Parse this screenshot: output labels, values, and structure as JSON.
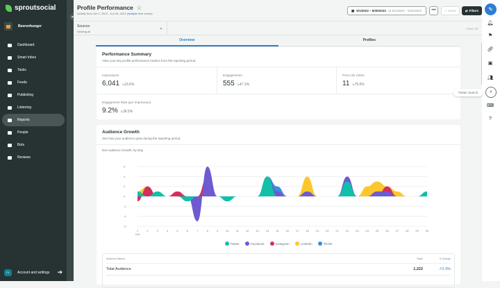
{
  "sidebar": {
    "brand": "sproutsocial",
    "group": "Beerenhunger",
    "items": [
      {
        "label": "Dashboard"
      },
      {
        "label": "Smart Inbox"
      },
      {
        "label": "Tasks"
      },
      {
        "label": "Feeds"
      },
      {
        "label": "Publishing"
      },
      {
        "label": "Listening"
      },
      {
        "label": "Reports",
        "active": true
      },
      {
        "label": "People"
      },
      {
        "label": "Bots"
      },
      {
        "label": "Reviews"
      }
    ],
    "account": {
      "initials": "FL",
      "label": "Account and settings"
    }
  },
  "header": {
    "title": "Profile Performance",
    "subtitle_prefix": "Activity from Jun 1, 2023 - Jun 30, 2023 (",
    "subtitle_link": "multiple",
    "subtitle_suffix": " time zones)",
    "date_range": "6/1/2023 – 6/30/2023",
    "compare": "vs 5/1/2023 – 5/31/2023",
    "more": "•••",
    "share": "Share",
    "filters": "Filters"
  },
  "sources": {
    "label": "Sources",
    "value": "Viewing all",
    "clear": "Clear All"
  },
  "tabs": [
    {
      "label": "Overview",
      "active": true
    },
    {
      "label": "Profiles"
    }
  ],
  "performance": {
    "title": "Performance Summary",
    "description": "View your key profile performance metrics from the reporting period.",
    "metrics": [
      {
        "label": "Impressions",
        "value": "6,041",
        "change": "↘16.6%"
      },
      {
        "label": "Engagements",
        "value": "555",
        "change": "↘47.1%"
      },
      {
        "label": "Post Link Clicks",
        "value": "11",
        "change": "↘75.6%"
      },
      {
        "label": "Engagement Rate (per Impression)",
        "value": "9.2%",
        "change": "↘36.5%"
      }
    ]
  },
  "audience": {
    "title": "Audience Growth",
    "description": "See how your audience grew during the reporting period.",
    "table": {
      "headers": [
        "Audience Metrics",
        "Totals",
        "% Change"
      ],
      "rows": [
        {
          "metric": "Total Audience",
          "total": "1,222",
          "change": "↗2.3%"
        }
      ]
    }
  },
  "chart_data": {
    "type": "area",
    "title": "Net Audience Growth, by Day",
    "x_month_label": "JUN",
    "x": [
      1,
      2,
      3,
      4,
      5,
      6,
      7,
      8,
      9,
      10,
      11,
      12,
      13,
      14,
      15,
      16,
      17,
      18,
      19,
      20,
      21,
      22,
      23,
      24,
      25,
      26,
      27,
      28,
      29,
      30
    ],
    "ylim": [
      -6,
      6
    ],
    "yticks": [
      6,
      4,
      2,
      0,
      -2,
      -4,
      -6
    ],
    "grid": true,
    "legend": "bottom",
    "series": [
      {
        "name": "LinkedIn",
        "color": "#fcc72c",
        "values": [
          1,
          2,
          0,
          0,
          0,
          0,
          0,
          0,
          0,
          0,
          0,
          0,
          0,
          0,
          0,
          0,
          0,
          4,
          0,
          0,
          0,
          0,
          0,
          2,
          3,
          2,
          1,
          0,
          0,
          0
        ]
      },
      {
        "name": "TikTok",
        "color": "#3b8fdb",
        "values": [
          0,
          0,
          0,
          0,
          0,
          0,
          0,
          0,
          0,
          0,
          0,
          0,
          0,
          4,
          2,
          0,
          0,
          0,
          0,
          0,
          0,
          0,
          0,
          0,
          0,
          0,
          0,
          0,
          0,
          0
        ]
      },
      {
        "name": "Instagram",
        "color": "#d2305c",
        "values": [
          -1,
          2,
          0,
          0,
          1,
          0,
          0,
          4,
          0,
          0,
          0,
          0,
          0,
          0,
          0,
          0,
          0,
          0,
          0,
          0,
          0,
          0,
          0,
          0,
          0,
          2,
          0,
          0,
          0,
          0
        ]
      },
      {
        "name": "Facebook",
        "color": "#6f5ad1",
        "values": [
          0,
          0,
          0,
          0,
          0,
          0,
          -5,
          6,
          0,
          0,
          0,
          0,
          0,
          4,
          1,
          0,
          0,
          1,
          0,
          0,
          0,
          4,
          0,
          0,
          1,
          1,
          0,
          0,
          0,
          0
        ]
      },
      {
        "name": "Twitter",
        "color": "#10c0a9",
        "values": [
          1,
          0,
          1,
          0,
          0,
          -1,
          0,
          0,
          0,
          -1,
          0,
          0,
          0,
          4,
          0,
          0,
          0,
          0,
          0,
          0,
          0,
          3,
          0,
          0,
          0,
          0,
          0,
          0,
          0,
          1
        ]
      }
    ],
    "legend_order": [
      "Twitter",
      "Facebook",
      "Instagram",
      "LinkedIn",
      "TikTok"
    ]
  }
}
